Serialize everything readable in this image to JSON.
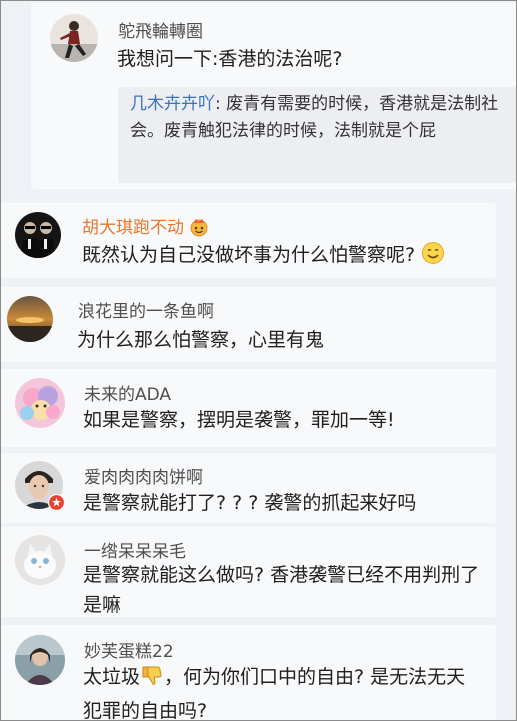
{
  "thread": {
    "author": "鸵飛輪轉圈",
    "question": "我想问一下:香港的法治呢?",
    "quoted_name": "几木卉卉吖",
    "quoted_text": ": 废青有需要的时候，香港就是法制社会。废青触犯法律的时候，法制就是个屁"
  },
  "comments": [
    {
      "name": "胡大琪跑不动",
      "text": "既然认为自己没做坏事为什么怕警察呢?"
    },
    {
      "name": "浪花里的一条鱼啊",
      "text": "为什么那么怕警察，心里有鬼"
    },
    {
      "name": "未来的ADA",
      "text": "如果是警察，摆明是袭警，罪加一等!"
    },
    {
      "name": "爱肉肉肉肉饼啊",
      "text": "是警察就能打了? ? ? 袭警的抓起来好吗"
    },
    {
      "name": "一绺呆呆呆毛",
      "text": "是警察就能这么做吗? 香港袭警已经不用判刑了是嘛"
    },
    {
      "name": "妙芙蛋糕22",
      "text_before": "太垃圾",
      "text_after": "，何为你们口中的自由? 是无法无天犯罪的自由吗?"
    }
  ],
  "icons": {
    "vip_badge": "vip-crown-icon",
    "smile_emoji": "smile-emoji",
    "thumbs_down": "thumbs-down-emoji",
    "verified_badge": "verified-badge-icon"
  },
  "colors": {
    "background": "#eef1f5",
    "card": "#f8f9fb",
    "quote_bg": "#eceef2",
    "link_blue": "#3a72c4",
    "vip_orange": "#e8762c"
  }
}
